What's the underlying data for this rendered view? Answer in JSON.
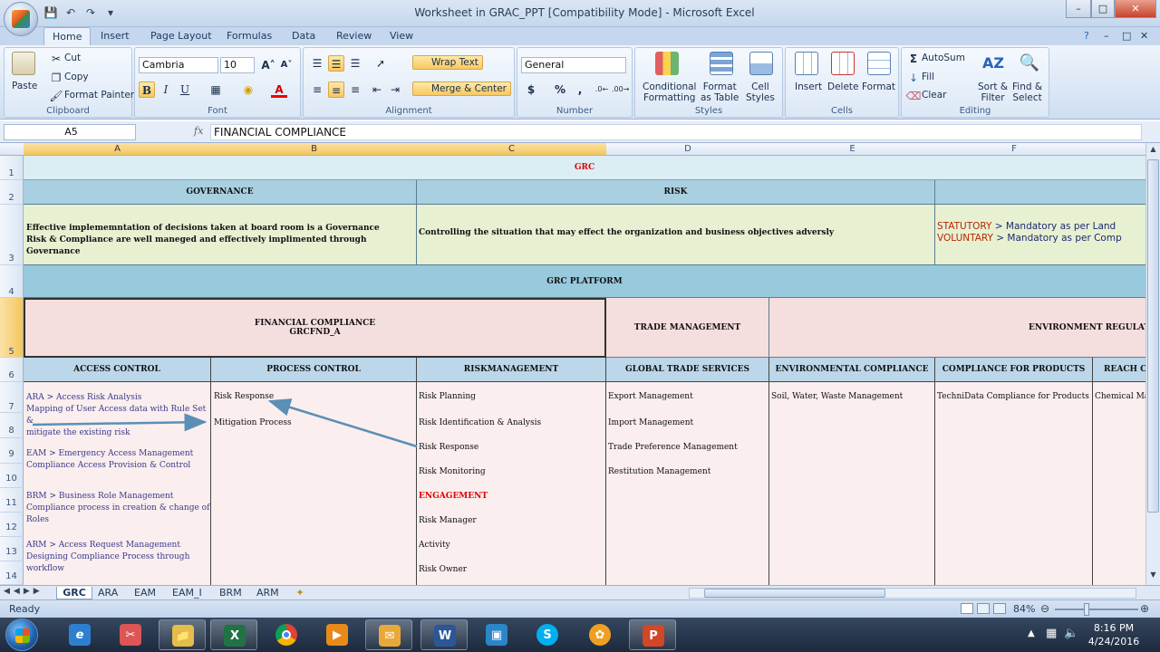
{
  "window": {
    "title": "Worksheet in GRAC_PPT  [Compatibility Mode] - Microsoft Excel",
    "minimize": "–",
    "restore": "□",
    "close": "✕"
  },
  "ribbon_tabs": [
    "Home",
    "Insert",
    "Page Layout",
    "Formulas",
    "Data",
    "Review",
    "View"
  ],
  "clipboard": {
    "paste": "Paste",
    "cut": "Cut",
    "copy": "Copy",
    "format_painter": "Format Painter",
    "label": "Clipboard"
  },
  "font": {
    "name": "Cambria",
    "size": "10",
    "bold": "B",
    "italic": "I",
    "underline": "U",
    "label": "Font"
  },
  "alignment": {
    "wrap_text": "Wrap Text",
    "merge_center": "Merge & Center",
    "label": "Alignment"
  },
  "number": {
    "format": "General",
    "currency": "$",
    "percent": "%",
    "comma": ",",
    "label": "Number"
  },
  "styles": {
    "conditional": "Conditional",
    "conditional2": "Formatting",
    "format_table": "Format",
    "format_table2": "as Table",
    "cell_styles": "Cell",
    "cell_styles2": "Styles",
    "label": "Styles"
  },
  "cells": {
    "insert": "Insert",
    "delete": "Delete",
    "format": "Format",
    "label": "Cells"
  },
  "editing": {
    "autosum": "AutoSum",
    "fill": "Fill",
    "clear": "Clear",
    "sort": "Sort &",
    "sort2": "Filter",
    "find": "Find &",
    "find2": "Select",
    "label": "Editing"
  },
  "formula_bar": {
    "name_box": "A5",
    "fx": "fx",
    "content": "FINANCIAL COMPLIANCE"
  },
  "columns": [
    "A",
    "B",
    "C",
    "D",
    "E",
    "F"
  ],
  "rows": [
    "1",
    "2",
    "3",
    "4",
    "5",
    "6",
    "7",
    "8",
    "9",
    "10",
    "11",
    "12",
    "13",
    "14"
  ],
  "sheet": {
    "grc": "GRC",
    "governance": "GOVERNANCE",
    "risk": "RISK",
    "gov_desc1": "Effective implememntation of decisions taken at board room is a Governance",
    "gov_desc2": "Risk & Compliance are well maneged and effectively implimented through Governance",
    "risk_desc": "Controlling the situation that may effect the organization and business objectives adversly",
    "statutory_label": "STATUTORY",
    "statutory_text": " > Mandatory as per Land",
    "voluntary_label": "VOLUNTARY",
    "voluntary_text": " > Mandatory as per Comp",
    "platform": "GRC PLATFORM",
    "fin_comp": "FINANCIAL COMPLIANCE",
    "fin_code": "GRCFND_A",
    "trade_mgmt": "TRADE MANAGEMENT",
    "env_reg": "ENVIRONMENT REGULATIO",
    "h_access": "ACCESS CONTROL",
    "h_process": "PROCESS CONTROL",
    "h_riskmgmt": "RISKMANAGEMENT",
    "h_gts": "GLOBAL TRADE SERVICES",
    "h_envcomp": "ENVIRONMENTAL COMPLIANCE",
    "h_products": "COMPLIANCE FOR PRODUCTS",
    "h_reach": "REACH CO",
    "a_ara1": "ARA > Access Risk Analysis",
    "a_ara2": "Mapping of User Access data with Rule Set &",
    "a_ara3": "mitigate the existing risk",
    "a_eam1": "EAM > Emergency Access Management",
    "a_eam2": "Compliance Access Provision & Control",
    "a_brm1": "BRM > Business Role Management",
    "a_brm2": "Compliance process in creation & change of",
    "a_brm3": "Roles",
    "a_arm1": "ARM > Access Request Management",
    "a_arm2": "Designing Compliance Process through",
    "a_arm3": "workflow",
    "b_risk_response": "Risk Response",
    "b_mitigation": "Mitigation Process",
    "c_items": [
      "Risk Planning",
      "Risk Identification & Analysis",
      "Risk Response",
      "Risk Monitoring",
      "ENGAGEMENT",
      "Risk Manager",
      "Activity",
      "Risk Owner"
    ],
    "d_items": [
      "Export Management",
      "Import Management",
      "Trade Preference Management",
      "Restitution Management"
    ],
    "e_item": "Soil, Water, Waste Management",
    "f_item": "TechniData Compliance for Products",
    "g_item": "Chemical Ma"
  },
  "sheet_tabs": [
    "GRC",
    "ARA",
    "EAM",
    "EAM_I",
    "BRM",
    "ARM"
  ],
  "status": {
    "ready": "Ready",
    "zoom": "84%"
  },
  "taskbar": {
    "time": "8:16 PM",
    "date": "4/24/2016"
  },
  "colors": {
    "header_blue": "#bcd7e9",
    "mid_blue": "#a9d0e0",
    "green": "#e8f0d2",
    "pink": "#f5dede",
    "light_pink": "#faeeee",
    "red": "#e00000",
    "link_blue": "#3b3b8c",
    "arrow": "#5b8fb5"
  }
}
